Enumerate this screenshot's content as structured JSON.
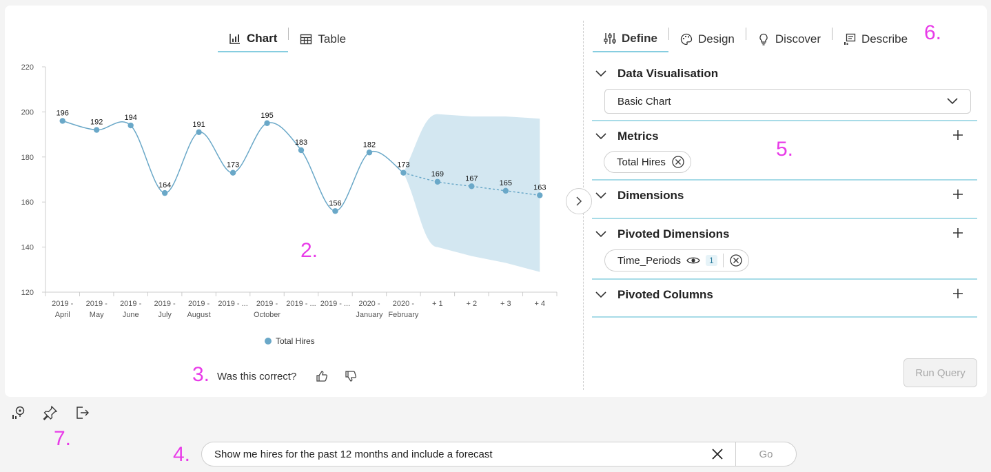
{
  "view_tabs": [
    {
      "label": "Chart",
      "active": true
    },
    {
      "label": "Table",
      "active": false
    }
  ],
  "right_tabs": [
    {
      "label": "Define",
      "active": true
    },
    {
      "label": "Design",
      "active": false
    },
    {
      "label": "Discover",
      "active": false
    },
    {
      "label": "Describe",
      "active": false
    }
  ],
  "sections": {
    "data_visualisation": {
      "title": "Data Visualisation",
      "selected": "Basic Chart"
    },
    "metrics": {
      "title": "Metrics",
      "chips": [
        "Total Hires"
      ]
    },
    "dimensions": {
      "title": "Dimensions"
    },
    "pivoted_dimensions": {
      "title": "Pivoted Dimensions",
      "chip": {
        "label": "Time_Periods",
        "badge": "1"
      }
    },
    "pivoted_columns": {
      "title": "Pivoted Columns"
    }
  },
  "run_query_label": "Run Query",
  "feedback": {
    "question": "Was this correct?"
  },
  "query": {
    "value": "Show me hires for the past 12 months and include a forecast",
    "go_label": "Go"
  },
  "annotations": [
    "2.",
    "3.",
    "4.",
    "5.",
    "6.",
    "7."
  ],
  "colors": {
    "accent": "#86cde0",
    "series": "#6aa8c8",
    "band": "#d3e7f1",
    "annotation": "#e83be8"
  },
  "chart_data": {
    "type": "line",
    "categories": [
      [
        "2019 -",
        "April"
      ],
      [
        "2019 -",
        "May"
      ],
      [
        "2019 -",
        "June"
      ],
      [
        "2019 -",
        "July"
      ],
      [
        "2019 -",
        "August"
      ],
      [
        "2019 - ..."
      ],
      [
        "2019 -",
        "October"
      ],
      [
        "2019 - ..."
      ],
      [
        "2019 - ..."
      ],
      [
        "2020 -",
        "January"
      ],
      [
        "2020 -",
        "February"
      ],
      [
        "+ 1"
      ],
      [
        "+ 2"
      ],
      [
        "+ 3"
      ],
      [
        "+ 4"
      ]
    ],
    "series": [
      {
        "name": "Total Hires",
        "values": [
          196,
          192,
          194,
          164,
          191,
          173,
          195,
          183,
          156,
          182,
          173,
          169,
          167,
          165,
          163
        ]
      }
    ],
    "forecast_start_index": 10,
    "forecast_band": {
      "upper": [
        173,
        199,
        198,
        198,
        197
      ],
      "lower": [
        173,
        140,
        136,
        133,
        129
      ]
    },
    "ylim": [
      120,
      220
    ],
    "yticks": [
      120,
      140,
      160,
      180,
      200,
      220
    ],
    "legend_position": "bottom"
  }
}
